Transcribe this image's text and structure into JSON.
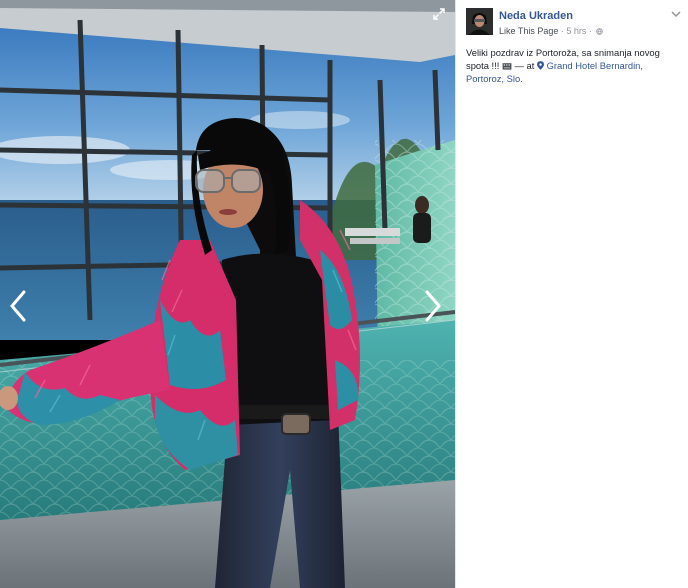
{
  "photo": {
    "description_icons": [
      "expand-icon",
      "chevron-left-icon",
      "chevron-right-icon"
    ]
  },
  "post": {
    "page_name": "Neda Ukraden",
    "like_page": "Like This Page",
    "separator": "·",
    "time": "5 hrs",
    "separator2": "·",
    "text_main": "Veliki pozdrav iz Portoroža, sa snimanja novog spota !!! ",
    "text_dash": " — at ",
    "location_line1": "Grand Hotel Bernardin,",
    "location_line2": "Portoroz, Slo.",
    "icons": [
      "globe-icon",
      "film-icon",
      "location-pin-icon",
      "chevron-down-icon"
    ]
  },
  "colors": {
    "link": "#365899",
    "meta": "#90949c",
    "text": "#1d2129",
    "pink": "#e0336f",
    "teal": "#2a8fa0",
    "sea": "#3a7fb0"
  }
}
